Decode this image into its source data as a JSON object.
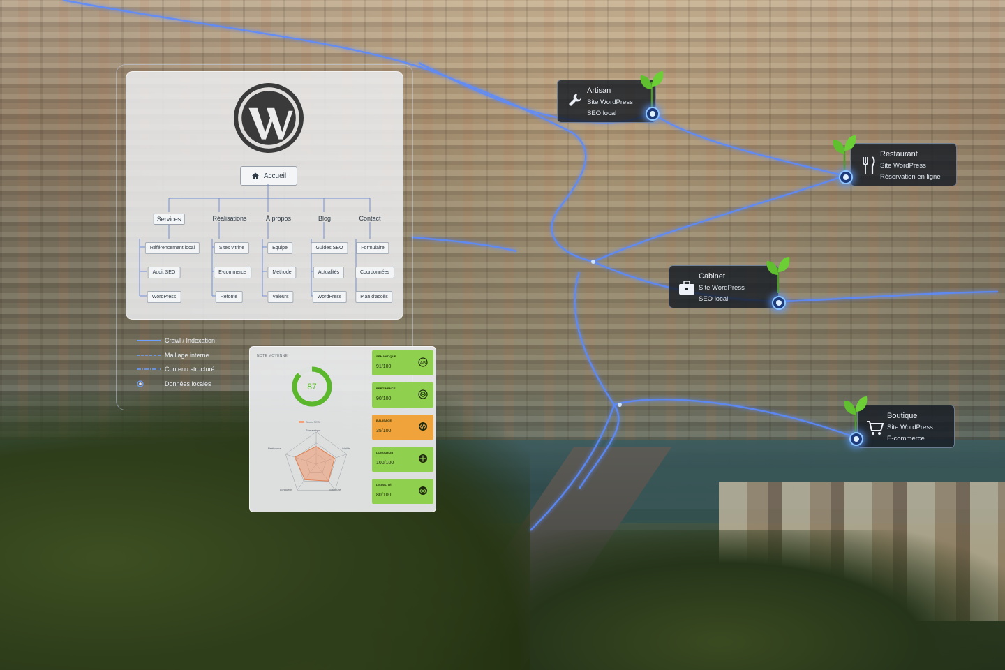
{
  "sitemap": {
    "home_label": "Accueil",
    "categories": [
      {
        "label": "Services",
        "items": [
          "Référencement local",
          "Audit SEO",
          "WordPress"
        ]
      },
      {
        "label": "Réalisations",
        "items": [
          "Sites vitrine",
          "E-commerce",
          "Refonte"
        ]
      },
      {
        "label": "À propos",
        "items": [
          "Equipe",
          "Méthode",
          "Valeurs"
        ]
      },
      {
        "label": "Blog",
        "items": [
          "Guides SEO",
          "Actualités",
          "WordPress"
        ]
      },
      {
        "label": "Contact",
        "items": [
          "Formulaire",
          "Coordonnées",
          "Plan d'accès"
        ]
      }
    ]
  },
  "legend": [
    {
      "label": "Crawl / Indexation",
      "style": "solid"
    },
    {
      "label": "Maillage interne",
      "style": "dashed"
    },
    {
      "label": "Contenu structuré",
      "style": "dash-dot"
    },
    {
      "label": "Données locales",
      "style": "node"
    }
  ],
  "score": {
    "title": "NOTE MOYENNE",
    "value": "87",
    "value_fraction": 0.87,
    "radar_legend": "Score SEO",
    "radar_axes": [
      "Sémantique",
      "Lisibilité",
      "Structure",
      "Longueur",
      "Pertinence"
    ],
    "radar_values": [
      0.55,
      0.6,
      0.65,
      0.6,
      0.7
    ],
    "metrics": [
      {
        "name": "SÉMANTIQUE",
        "value": "91/100",
        "color": "#8fd14f",
        "icon": "ab-icon"
      },
      {
        "name": "PERTINENCE",
        "value": "90/100",
        "color": "#8fd14f",
        "icon": "target-icon"
      },
      {
        "name": "BALISAGE",
        "value": "35/100",
        "color": "#f0a33a",
        "icon": "code-icon"
      },
      {
        "name": "LONGUEUR",
        "value": "100/100",
        "color": "#8fd14f",
        "icon": "move-icon"
      },
      {
        "name": "LISIBILITÉ",
        "value": "80/100",
        "color": "#8fd14f",
        "icon": "glasses-icon"
      }
    ]
  },
  "cards": [
    {
      "title": "Artisan",
      "line1": "Site WordPress",
      "line2": "SEO local",
      "icon": "wrench-icon"
    },
    {
      "title": "Restaurant",
      "line1": "Site WordPress",
      "line2": "Réservation en ligne",
      "icon": "cutlery-icon"
    },
    {
      "title": "Cabinet",
      "line1": "Site WordPress",
      "line2": "SEO local",
      "icon": "briefcase-icon"
    },
    {
      "title": "Boutique",
      "line1": "Site WordPress",
      "line2": "E-commerce",
      "icon": "cart-icon"
    }
  ],
  "colors": {
    "route": "#4a7dff",
    "route_glow": "#9cc3ff",
    "good": "#8fd14f",
    "warn": "#f0a33a",
    "gauge": "#5bb82c"
  }
}
